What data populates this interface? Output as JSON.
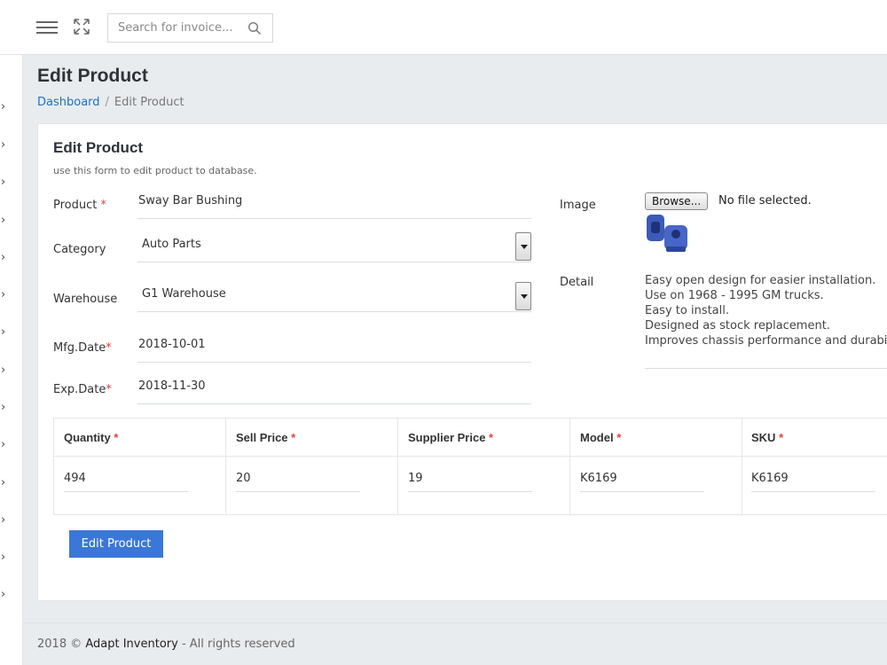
{
  "topbar": {
    "search_placeholder": "Search for invoice..."
  },
  "header": {
    "title": "Edit Product",
    "breadcrumb": {
      "home": "Dashboard",
      "separator": "/",
      "current": "Edit Product"
    }
  },
  "form": {
    "title": "Edit Product",
    "subtitle": "use this form to edit product to database.",
    "product": {
      "label": "Product",
      "required": "*",
      "value": "Sway Bar Bushing"
    },
    "category": {
      "label": "Category",
      "value": "Auto Parts"
    },
    "warehouse": {
      "label": "Warehouse",
      "value": "G1 Warehouse"
    },
    "mfg": {
      "label": "Mfg.Date",
      "required": "*",
      "value": "2018-10-01"
    },
    "exp": {
      "label": "Exp.Date",
      "required": "*",
      "value": "2018-11-30"
    },
    "image": {
      "label": "Image",
      "browse_label": "Browse...",
      "status": "No file selected."
    },
    "detail": {
      "label": "Detail",
      "lines": [
        "Easy open design for easier installation.",
        "Use on 1968 - 1995 GM trucks.",
        "Easy to install.",
        "Designed as stock replacement.",
        "Improves chassis performance and durability."
      ]
    },
    "table": {
      "columns": [
        {
          "label": "Quantity",
          "required": "*",
          "value": "494"
        },
        {
          "label": "Sell Price",
          "required": "*",
          "value": "20"
        },
        {
          "label": "Supplier Price",
          "required": "*",
          "value": "19"
        },
        {
          "label": "Model",
          "required": "*",
          "value": "K6169"
        },
        {
          "label": "SKU",
          "required": "*",
          "value": "K6169"
        }
      ]
    },
    "submit_label": "Edit Product"
  },
  "footer": {
    "year": "2018 ©",
    "brand": "Adapt Inventory",
    "rights": "- All rights reserved"
  },
  "icons": {
    "menu": "hamburger-icon",
    "expand": "fullscreen-icon",
    "search": "search-icon",
    "rail": "chevron-right-icon"
  },
  "colors": {
    "accent": "#3b77d8",
    "link": "#1e6fc2",
    "required": "#e0413c",
    "product_image": "#3b5bb8"
  }
}
